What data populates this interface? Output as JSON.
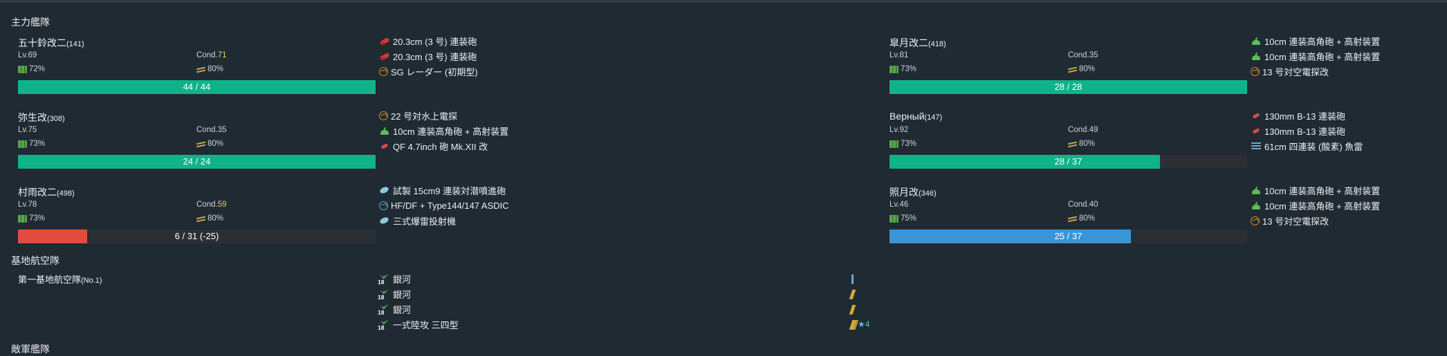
{
  "sections": {
    "main_fleet": "主力艦隊",
    "base_air": "基地航空隊",
    "enemy_fleet": "敵軍艦隊"
  },
  "ships": [
    {
      "name": "五十鈴改二",
      "id": "(141)",
      "lv": "Lv.69",
      "cond_label": "Cond.",
      "cond_value": "71",
      "fuel": "72%",
      "ammo": "80%",
      "hp": "44 / 44",
      "hp_frac": 1.0,
      "hp_color": "#0fb38a",
      "equip": [
        {
          "icon": "gun-red",
          "label": "20.3cm (3 号) 連装砲"
        },
        {
          "icon": "gun-red",
          "label": "20.3cm (3 号) 連装砲"
        },
        {
          "icon": "radar",
          "label": "SG レーダー (初期型)"
        }
      ]
    },
    {
      "name": "弥生改",
      "id": "(308)",
      "lv": "Lv.75",
      "cond_label": "Cond.",
      "cond_value": "35",
      "fuel": "73%",
      "ammo": "80%",
      "hp": "24 / 24",
      "hp_frac": 1.0,
      "hp_color": "#0fb38a",
      "equip": [
        {
          "icon": "radar",
          "label": "22 号対水上電探"
        },
        {
          "icon": "gun-green",
          "label": "10cm 連装高角砲 + 高射装置"
        },
        {
          "icon": "gun-red-sm",
          "label": "QF 4.7inch 砲 Mk.XII 改"
        }
      ]
    },
    {
      "name": "村雨改二",
      "id": "(498)",
      "lv": "Lv.78",
      "cond_label": "Cond.",
      "cond_value": "59",
      "fuel": "73%",
      "ammo": "80%",
      "hp": "6 / 31 (-25)",
      "hp_frac": 0.194,
      "hp_color": "#e34b3c",
      "equip": [
        {
          "icon": "dc",
          "label": "試製 15cm9 連装対潜噴進砲"
        },
        {
          "icon": "sonar",
          "label": "HF/DF + Type144/147 ASDIC"
        },
        {
          "icon": "dc",
          "label": "三式爆雷投射機"
        }
      ]
    },
    {
      "name": "皐月改二",
      "id": "(418)",
      "lv": "Lv.81",
      "cond_label": "Cond.",
      "cond_value": "35",
      "fuel": "73%",
      "ammo": "80%",
      "hp": "28 / 28",
      "hp_frac": 1.0,
      "hp_color": "#0fb38a",
      "equip": [
        {
          "icon": "gun-green",
          "label": "10cm 連装高角砲 + 高射装置"
        },
        {
          "icon": "gun-green",
          "label": "10cm 連装高角砲 + 高射装置"
        },
        {
          "icon": "radar",
          "label": "13 号対空電探改"
        }
      ]
    },
    {
      "name": "Верный",
      "id": "(147)",
      "lv": "Lv.92",
      "cond_label": "Cond.",
      "cond_value": "49",
      "fuel": "73%",
      "ammo": "80%",
      "hp": "28 / 37",
      "hp_frac": 0.757,
      "hp_color": "#0fb38a",
      "equip": [
        {
          "icon": "gun-red-sm",
          "label": "130mm B-13 連装砲"
        },
        {
          "icon": "gun-red-sm",
          "label": "130mm B-13 連装砲"
        },
        {
          "icon": "torp",
          "label": "61cm 四連装 (酸素) 魚雷"
        }
      ]
    },
    {
      "name": "照月改",
      "id": "(346)",
      "lv": "Lv.46",
      "cond_label": "Cond.",
      "cond_value": "40",
      "fuel": "75%",
      "ammo": "80%",
      "hp": "25 / 37",
      "hp_frac": 0.676,
      "hp_color": "#3a95d8",
      "equip": [
        {
          "icon": "gun-green",
          "label": "10cm 連装高角砲 + 高射装置"
        },
        {
          "icon": "gun-green",
          "label": "10cm 連装高角砲 + 高射装置"
        },
        {
          "icon": "radar",
          "label": "13 号対空電探改"
        }
      ]
    }
  ],
  "air_base": {
    "name": "第一基地航空隊",
    "no": "(No.1)",
    "planes": [
      {
        "count": "18",
        "label": "銀河",
        "prof": "blue",
        "star": ""
      },
      {
        "count": "18",
        "label": "銀河",
        "prof": "y1",
        "star": ""
      },
      {
        "count": "18",
        "label": "銀河",
        "prof": "y1",
        "star": ""
      },
      {
        "count": "18",
        "label": "一式陸攻 三四型",
        "prof": "y2",
        "star": "★4"
      }
    ]
  },
  "colors": {
    "bg": "#1f2a33",
    "hp_green": "#0fb38a",
    "hp_red": "#e34b3c",
    "hp_blue": "#3a95d8",
    "cond_sparkle": "#e5d44b"
  }
}
